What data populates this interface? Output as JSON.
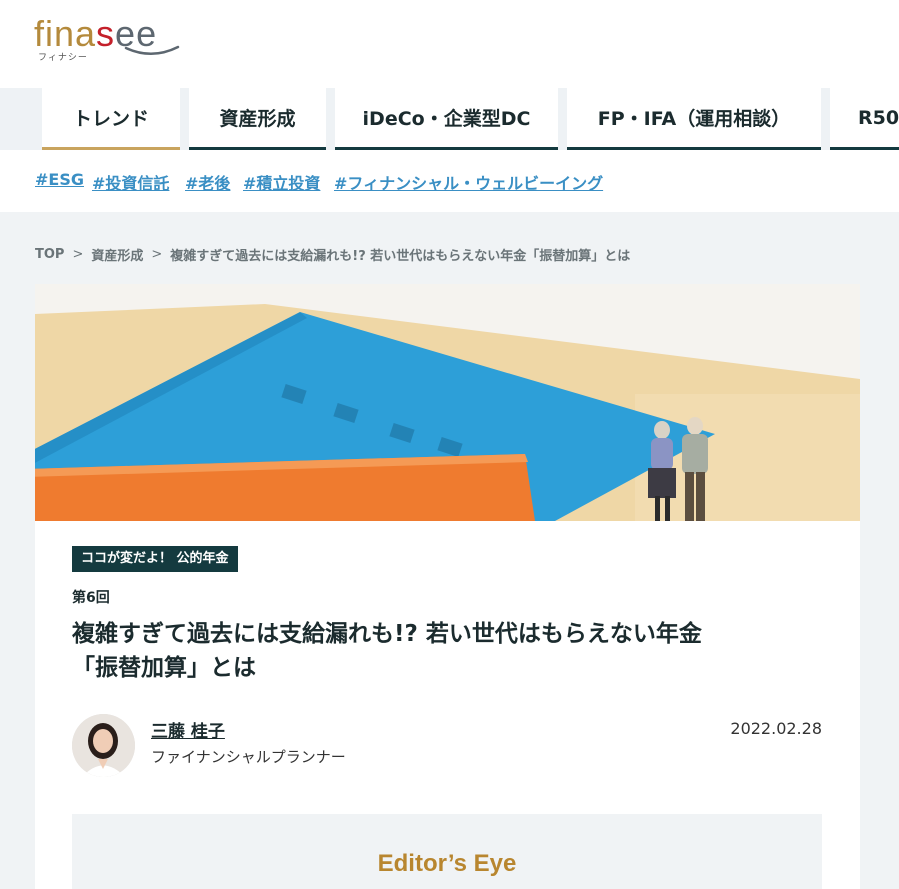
{
  "logo": {
    "text_gold": "fina",
    "text_red": "s",
    "text_gray": "ee",
    "sub": "フィナシー"
  },
  "nav": {
    "items": [
      {
        "label": "トレンド"
      },
      {
        "label": "資産形成"
      },
      {
        "label": "iDeCo・企業型DC"
      },
      {
        "label": "FP・IFA（運用相談）"
      },
      {
        "label": "R50"
      }
    ]
  },
  "tags": [
    "#ESG",
    "#投資信託",
    "#老後",
    "#積立投資",
    "#フィナンシャル・ウェルビーイング"
  ],
  "breadcrumb": {
    "items": [
      "TOP",
      "資産形成",
      "複雑すぎて過去には支給漏れも!? 若い世代はもらえない年金「振替加算」とは"
    ],
    "separator": ">"
  },
  "article": {
    "series_badge": "ココが変だよ！ 公的年金",
    "episode": "第6回",
    "title_line1": "複雑すぎて過去には支給漏れも!? 若い世代はもらえない年金",
    "title_line2": "「振替加算」とは",
    "author_name": "三藤 桂子",
    "author_role": "ファイナンシャルプランナー",
    "date": "2022.02.28"
  },
  "editor": {
    "title": "Editor’s Eye"
  },
  "colors": {
    "accent_dark": "#143a3f",
    "accent_gold": "#c9a45e",
    "tag_blue": "#3a8fc4"
  }
}
